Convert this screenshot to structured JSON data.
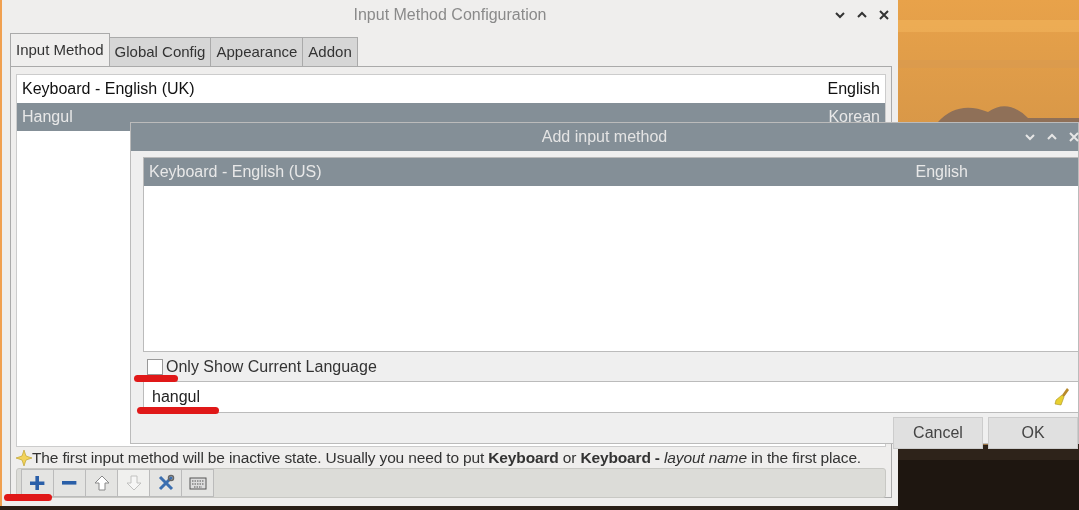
{
  "main_window": {
    "title": "Input Method Configuration",
    "tabs": [
      {
        "label": "Input Method",
        "selected": true
      },
      {
        "label": "Global Config",
        "selected": false
      },
      {
        "label": "Appearance",
        "selected": false
      },
      {
        "label": "Addon",
        "selected": false
      }
    ],
    "input_methods": [
      {
        "name": "Keyboard - English (UK)",
        "language": "English",
        "selected": false
      },
      {
        "name": "Hangul",
        "language": "Korean",
        "selected": true
      }
    ],
    "hint": "The first input method will be inactive state. Usually you need to put **Keyboard** or **Keyboard -** *layout name* in the first place.",
    "toolbar": [
      {
        "kind": "add",
        "disabled": false
      },
      {
        "kind": "remove",
        "disabled": false
      },
      {
        "kind": "up",
        "disabled": false
      },
      {
        "kind": "down",
        "disabled": true
      },
      {
        "kind": "configure",
        "disabled": false
      },
      {
        "kind": "keyboard",
        "disabled": false
      }
    ]
  },
  "dialog": {
    "title": "Add input method",
    "methods": [
      {
        "name": "Keyboard - English (US)",
        "language": "English",
        "selected": true
      }
    ],
    "only_current_language": {
      "label": "Only Show Current Language",
      "checked": false
    },
    "search": {
      "value": "hangul"
    },
    "buttons": [
      "Cancel",
      "OK"
    ]
  }
}
